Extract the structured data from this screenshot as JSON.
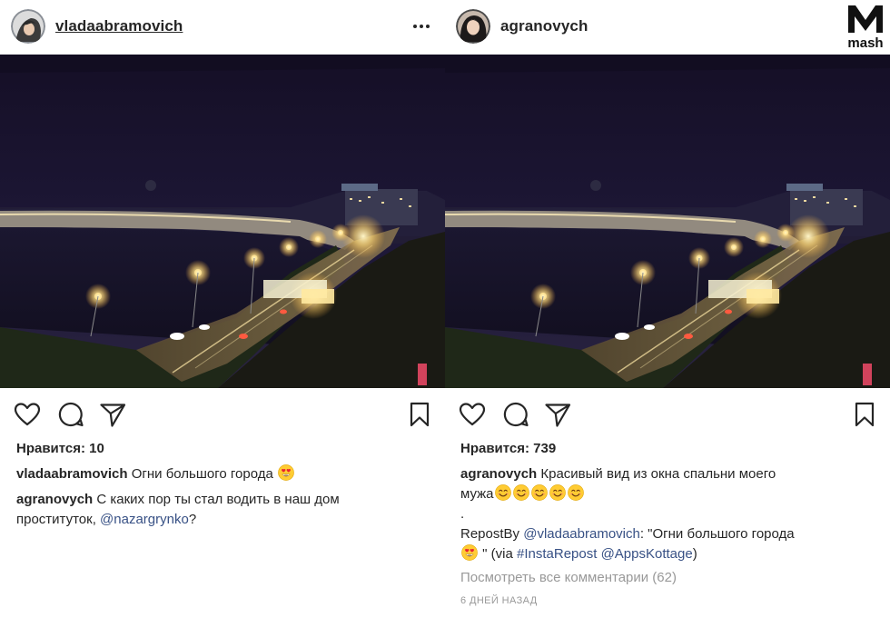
{
  "left_post": {
    "username": "vladaabramovich",
    "likes_label": "Нравится: 10",
    "caption": {
      "username": "vladaabramovich",
      "text": "Огни большого города"
    },
    "comment": {
      "username": "agranovych",
      "text_line1": "С каких пор ты стал водить в наш дом",
      "text_line2": "проституток,",
      "mention": "@nazargrynko",
      "suffix": "?"
    }
  },
  "right_post": {
    "username": "agranovych",
    "likes_label": "Нравится: 739",
    "caption": {
      "username": "agranovych",
      "text_line1": "Красивый вид из окна спальни моего",
      "text_line2": "мужа",
      "dot": "."
    },
    "repost": {
      "prefix": "RepostBy",
      "mention": "@vladaabramovich",
      "quote": ": \"Огни большого города",
      "close": " \" (via",
      "hashtag": "#InstaRepost",
      "mention2": "@AppsKottage",
      "end": ")"
    },
    "view_all_comments": "Посмотреть все комментарии (62)",
    "timestamp": "6 ДНЕЙ НАЗАД"
  },
  "watermark": {
    "brand": "mash"
  },
  "icons": [
    "more-icon",
    "heart-icon",
    "comment-icon",
    "share-icon",
    "bookmark-icon",
    "heart-eyes-emoji",
    "smiling-emoji"
  ],
  "colors": {
    "link": "#385185",
    "muted": "#999999",
    "text": "#262626",
    "night_sky": "#1a1330"
  }
}
